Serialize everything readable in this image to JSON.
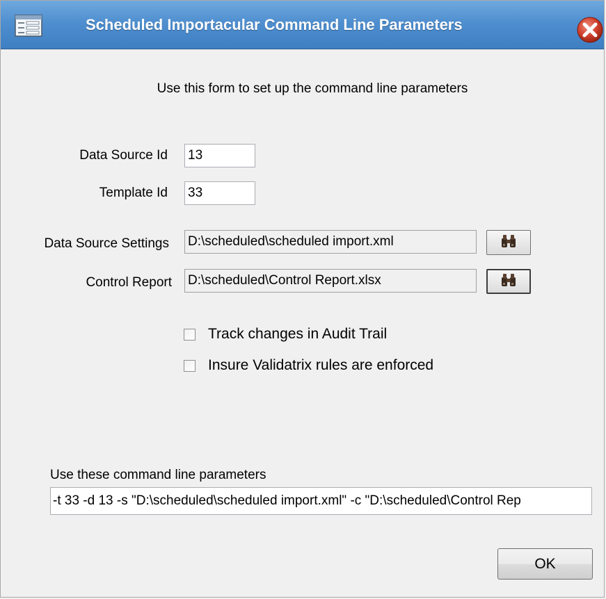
{
  "window": {
    "title": "Scheduled Importacular Command Line Parameters"
  },
  "intro_text": "Use this form to set up the command line parameters",
  "fields": {
    "data_source_id": {
      "label": "Data Source Id",
      "value": "13"
    },
    "template_id": {
      "label": "Template Id",
      "value": "33"
    },
    "data_source_settings": {
      "label": "Data Source Settings",
      "value": "D:\\scheduled\\scheduled import.xml"
    },
    "control_report": {
      "label": "Control Report",
      "value": "D:\\scheduled\\Control Report.xlsx"
    }
  },
  "options": {
    "track_changes": {
      "label": "Track changes in Audit Trail",
      "checked": false
    },
    "validatrix": {
      "label": "Insure Validatrix rules are enforced",
      "checked": false
    }
  },
  "command_line": {
    "label": "Use these command line parameters",
    "value": "-t 33 -d 13 -s \"D:\\scheduled\\scheduled import.xml\" -c \"D:\\scheduled\\Control Rep"
  },
  "buttons": {
    "ok": "OK"
  },
  "icons": {
    "window": "form-icon",
    "close": "close-icon",
    "browse": "binoculars-icon"
  },
  "colors": {
    "titlebar": "#4f8fcf",
    "close": "#c0392b"
  }
}
